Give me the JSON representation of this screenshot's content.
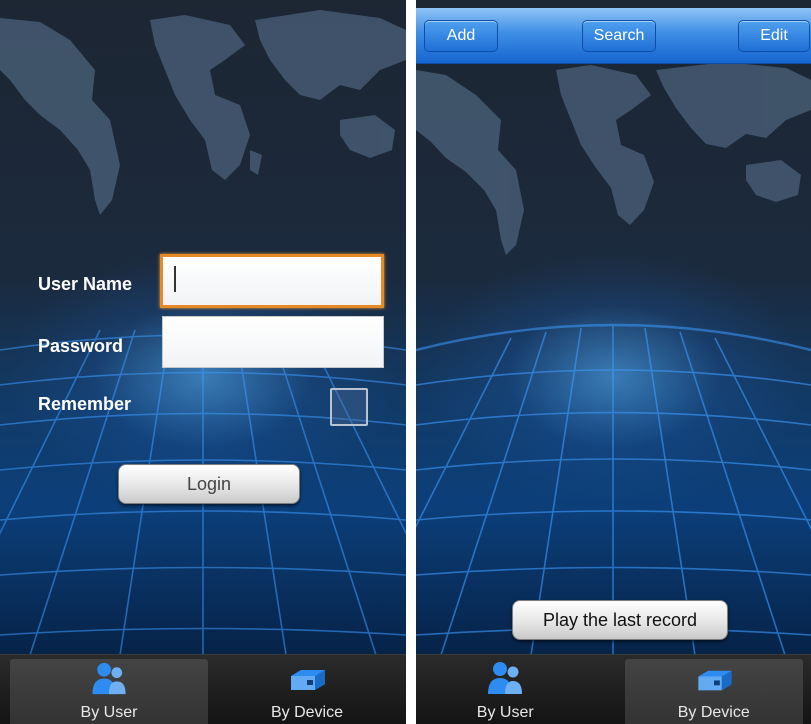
{
  "login_screen": {
    "form": {
      "username_label": "User Name",
      "username_value": "",
      "password_label": "Password",
      "password_value": "",
      "remember_label": "Remember",
      "remember_checked": false
    },
    "login_label": "Login",
    "tabs": [
      {
        "label": "By User",
        "icon": "users-icon",
        "active": true
      },
      {
        "label": "By Device",
        "icon": "device-icon",
        "active": false
      }
    ]
  },
  "device_screen": {
    "toolbar": {
      "add_label": "Add",
      "search_label": "Search",
      "edit_label": "Edit"
    },
    "play_last_label": "Play the last record",
    "tabs": [
      {
        "label": "By User",
        "icon": "users-icon",
        "active": false
      },
      {
        "label": "By Device",
        "icon": "device-icon",
        "active": true
      }
    ]
  },
  "colors": {
    "focus_border": "#e58a25",
    "toolbar_blue": "#1f6fd6",
    "background_dark": "#1b2a3d",
    "grid_blue": "#3d9bff"
  }
}
